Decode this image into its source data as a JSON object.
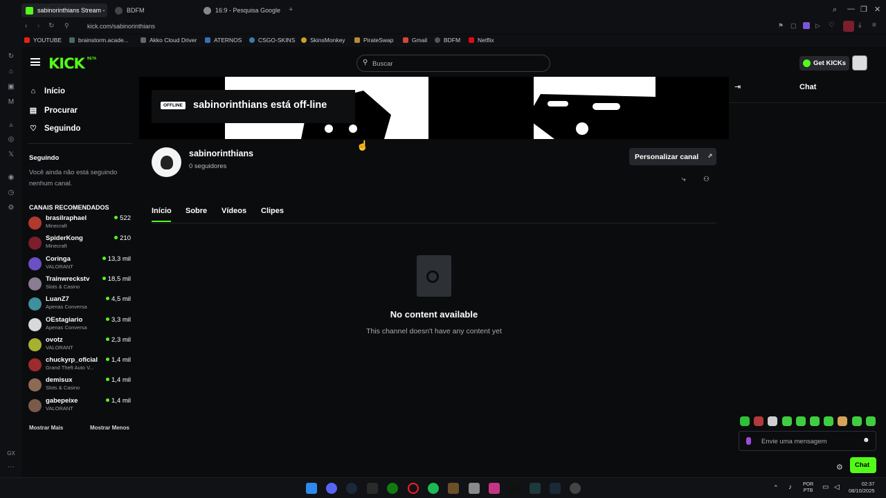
{
  "browser": {
    "tabs": [
      {
        "label": "sabinorinthians Stream - ",
        "active": true,
        "icon": "kick-favicon"
      },
      {
        "label": "BDFM",
        "active": false,
        "icon": "eye-favicon"
      },
      {
        "label": "16:9 - Pesquisa Google",
        "active": false,
        "icon": "google-favicon"
      }
    ],
    "url": "kick.com/sabinorinthians",
    "bookmarks": [
      "YOUTUBE",
      "brainstorm.acade...",
      "Akko Cloud Driver",
      "ATERNOS",
      "CSGO-SKINS",
      "SkinsMonkey",
      "PirateSwap",
      "Gmail",
      "BDFM",
      "Netflix"
    ]
  },
  "topnav": {
    "logo": "KICK",
    "logo_sup": "BETA",
    "search_placeholder": "Buscar",
    "get_kicks": "Get KICKs"
  },
  "sidebar": {
    "nav": [
      {
        "label": "Início",
        "icon": "home-icon"
      },
      {
        "label": "Procurar",
        "icon": "browse-icon"
      },
      {
        "label": "Seguindo",
        "icon": "heart-icon"
      }
    ],
    "following_title": "Seguindo",
    "following_empty": "Você ainda não está seguindo nenhum canal.",
    "recommended_title": "CANAIS RECOMENDADOS",
    "recommended": [
      {
        "name": "brasilraphael",
        "game": "Minecraft",
        "viewers": "522",
        "color": "#b03a2e"
      },
      {
        "name": "SpiderKong",
        "game": "Minecraft",
        "viewers": "210",
        "color": "#7a1f2b"
      },
      {
        "name": "Coringa",
        "game": "VALORANT",
        "viewers": "13,3 mil",
        "color": "#6b4fc4"
      },
      {
        "name": "Trainwreckstv",
        "game": "Slots & Casino",
        "viewers": "18,5 mil",
        "color": "#8a7d92"
      },
      {
        "name": "LuanZ7",
        "game": "Apenas Conversa",
        "viewers": "4,5 mil",
        "color": "#3f8f9c"
      },
      {
        "name": "OEstagiario",
        "game": "Apenas Conversa",
        "viewers": "3,3 mil",
        "color": "#d9d9d9"
      },
      {
        "name": "ovotz",
        "game": "VALORANT",
        "viewers": "2,3 mil",
        "color": "#a6b22e"
      },
      {
        "name": "chuckyrp_oficial",
        "game": "Grand Theft Auto V...",
        "viewers": "1,4 mil",
        "color": "#9c2b2b"
      },
      {
        "name": "demisux",
        "game": "Slots & Casino",
        "viewers": "1,4 mil",
        "color": "#8c6a55"
      },
      {
        "name": "gabepeixe",
        "game": "VALORANT",
        "viewers": "1,4 mil",
        "color": "#7a5a4a"
      }
    ],
    "show_more": "Mostrar Mais",
    "show_less": "Mostrar Menos",
    "gx_label": "GX"
  },
  "channel": {
    "offline_badge": "OFFLINE",
    "offline_text": "sabinorinthians está off-line",
    "name": "sabinorinthians",
    "followers": "0 seguidores",
    "customize_button": "Personalizar canal",
    "tabs": [
      "Início",
      "Sobre",
      "Vídeos",
      "Clipes"
    ],
    "empty_title": "No content available",
    "empty_subtitle": "This channel doesn't have any content yet"
  },
  "chat": {
    "title": "Chat",
    "input_placeholder": "Envie uma mensagem",
    "send_button": "Chat"
  },
  "taskbar": {
    "lang": "POR",
    "lang2": "PTB",
    "time": "02:37",
    "date": "08/10/2025"
  },
  "colors": {
    "accent": "#53fc18",
    "background": "#0b0c0e"
  }
}
